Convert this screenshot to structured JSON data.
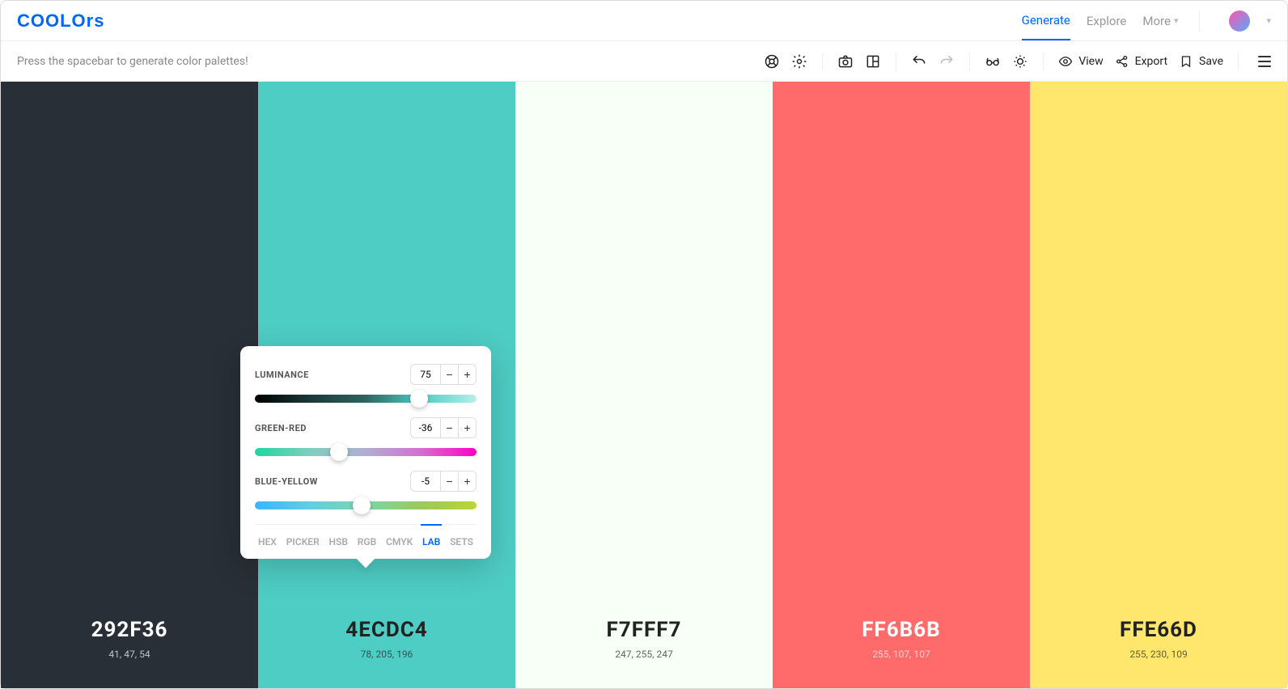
{
  "brand": "COOLOrs",
  "nav": {
    "generate": "Generate",
    "explore": "Explore",
    "more": "More"
  },
  "toolbar": {
    "hint": "Press the spacebar to generate color palettes!",
    "view": "View",
    "export": "Export",
    "save": "Save"
  },
  "palette": [
    {
      "hex": "292F36",
      "rgb": "41, 47, 54",
      "bg": "#292F36",
      "tone": "light"
    },
    {
      "hex": "4ECDC4",
      "rgb": "78, 205, 196",
      "bg": "#4ECDC4",
      "tone": "dark"
    },
    {
      "hex": "F7FFF7",
      "rgb": "247, 255, 247",
      "bg": "#F7FFF7",
      "tone": "dark"
    },
    {
      "hex": "FF6B6B",
      "rgb": "255, 107, 107",
      "bg": "#FF6B6B",
      "tone": "light"
    },
    {
      "hex": "FFE66D",
      "rgb": "255, 230, 109",
      "bg": "#FFE66D",
      "tone": "dark"
    }
  ],
  "lab": {
    "sliders": [
      {
        "label": "LUMINANCE",
        "value": "75",
        "thumb_pct": 74
      },
      {
        "label": "GREEN-RED",
        "value": "-36",
        "thumb_pct": 38
      },
      {
        "label": "BLUE-YELLOW",
        "value": "-5",
        "thumb_pct": 48
      }
    ],
    "tabs": [
      "HEX",
      "PICKER",
      "HSB",
      "RGB",
      "CMYK",
      "LAB",
      "SETS"
    ],
    "active_tab": "LAB"
  }
}
